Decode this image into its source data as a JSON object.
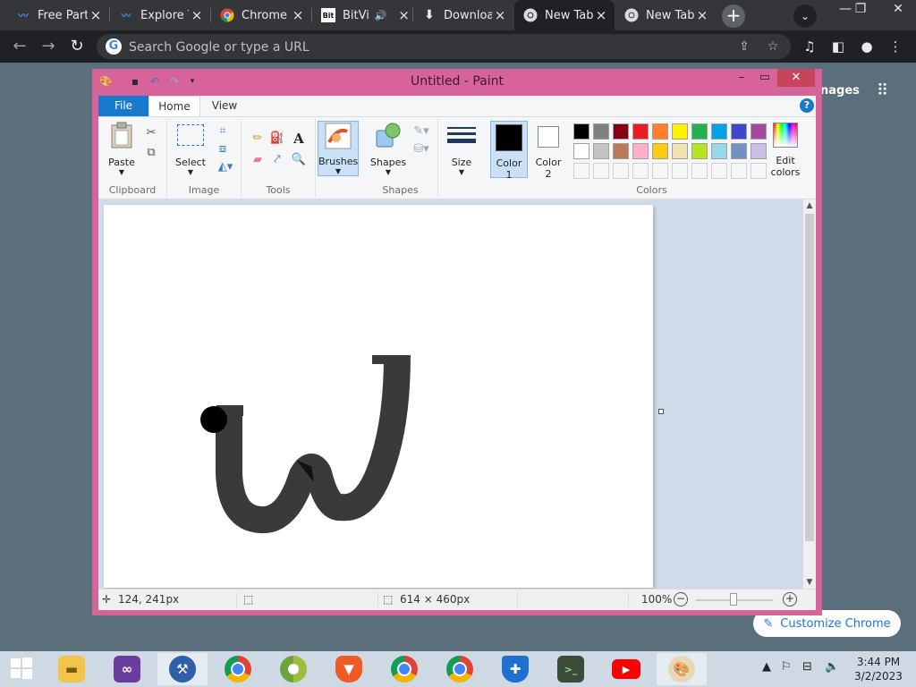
{
  "chrome": {
    "tabs": [
      {
        "title": "Free Part",
        "icon": "mural-icon"
      },
      {
        "title": "Explore T",
        "icon": "mural-icon"
      },
      {
        "title": "Chrome",
        "icon": "chrome-icon"
      },
      {
        "title": "BitVi",
        "icon": "bitvid-icon",
        "favicon_text": "Bit"
      },
      {
        "title": "Downloa",
        "icon": "download-icon"
      },
      {
        "title": "New Tab",
        "icon": "chrome-icon"
      },
      {
        "title": "New Tab",
        "icon": "chrome-icon"
      }
    ],
    "omnibox_placeholder": "Search Google or type a URL",
    "newtab": {
      "images_label": "nages",
      "customize_label": "Customize Chrome"
    }
  },
  "paint": {
    "title": "Untitled - Paint",
    "ribbon_tabs": [
      "File",
      "Home",
      "View"
    ],
    "groups": {
      "clipboard": {
        "label": "Clipboard",
        "paste": "Paste"
      },
      "image": {
        "label": "Image",
        "select": "Select"
      },
      "tools": {
        "label": "Tools"
      },
      "brushes": {
        "label": "Brushes"
      },
      "shapes": {
        "label": "Shapes",
        "button": "Shapes"
      },
      "size": {
        "label": "Size"
      },
      "colors": {
        "label": "Colors",
        "color1": "Color",
        "color1_num": "1",
        "color2": "Color",
        "color2_num": "2",
        "edit": "Edit",
        "edit2": "colors"
      }
    },
    "palette_row1": [
      "#000000",
      "#7f7f7f",
      "#880015",
      "#ed1c24",
      "#ff7f27",
      "#fff200",
      "#22b14c",
      "#00a2e8",
      "#3f48cc",
      "#a349a4"
    ],
    "palette_row2": [
      "#ffffff",
      "#c3c3c3",
      "#b97a57",
      "#ffaec9",
      "#ffc90e",
      "#efe4b0",
      "#b5e61d",
      "#99d9ea",
      "#7092be",
      "#c8bfe7"
    ],
    "color1_value": "#000000",
    "color2_value": "#ffffff",
    "status": {
      "cursor_pos": "124, 241px",
      "canvas_size": "614 × 460px",
      "zoom": "100%"
    }
  },
  "taskbar": {
    "apps": [
      "file-explorer",
      "visual-studio",
      "tools",
      "chrome",
      "chrome-canary",
      "brave",
      "chrome-profile",
      "chrome-profile-2",
      "windows-security",
      "terminal",
      "youtube",
      "paint"
    ],
    "clock_time": "3:44 PM",
    "clock_date": "3/2/2023"
  }
}
